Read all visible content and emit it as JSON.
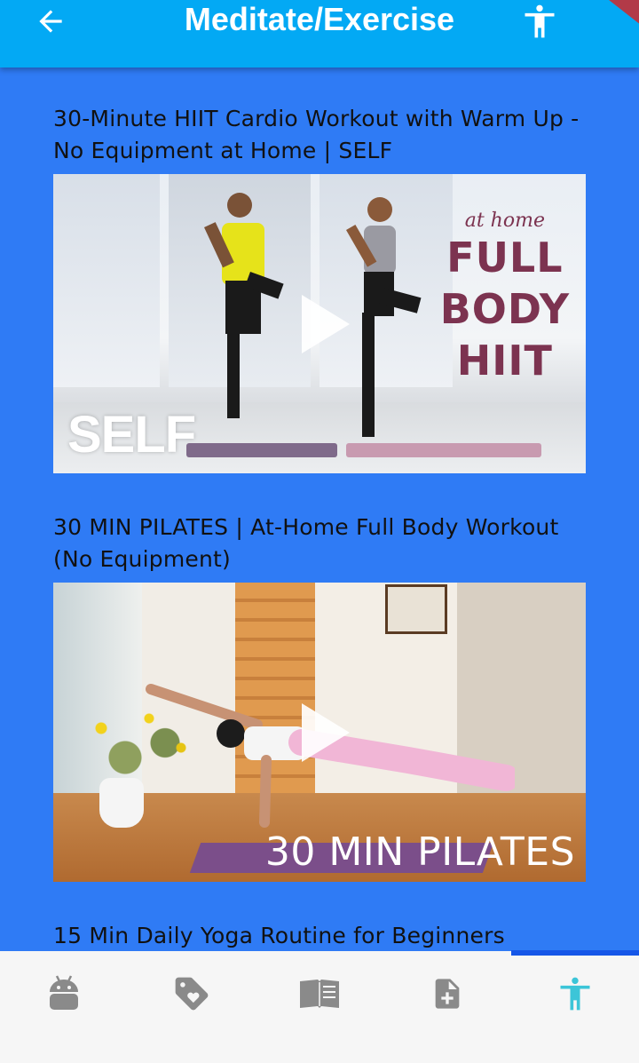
{
  "appbar": {
    "title": "Meditate/Exercise",
    "back_icon": "arrow-left-icon",
    "action_icon": "accessibility-icon"
  },
  "videos": [
    {
      "title": "30-Minute HIIT Cardio Workout with Warm Up - No Equipment at Home | SELF",
      "thumb_text": {
        "line1": "at home",
        "line2": "FULL",
        "line3": "BODY",
        "line4": "HIIT",
        "brand": "SELF"
      }
    },
    {
      "title": "30 MIN PILATES | At-Home Full Body Workout (No Equipment)",
      "thumb_text": {
        "brand": "30 MIN PILATES"
      }
    },
    {
      "title": "15 Min Daily Yoga Routine for Beginners"
    }
  ],
  "bottom_nav": {
    "items": [
      {
        "icon": "android-icon",
        "active": false
      },
      {
        "icon": "tag-heart-icon",
        "active": false
      },
      {
        "icon": "book-icon",
        "active": false
      },
      {
        "icon": "add-document-icon",
        "active": false
      },
      {
        "icon": "accessibility-icon",
        "active": true
      }
    ]
  },
  "colors": {
    "appbar": "#03A9F4",
    "background": "#2F7BF5",
    "nav_background": "#F6F6F6",
    "nav_active": "#3CC5D8",
    "nav_inactive": "#8A8A8A",
    "indicator": "#1657E8"
  }
}
